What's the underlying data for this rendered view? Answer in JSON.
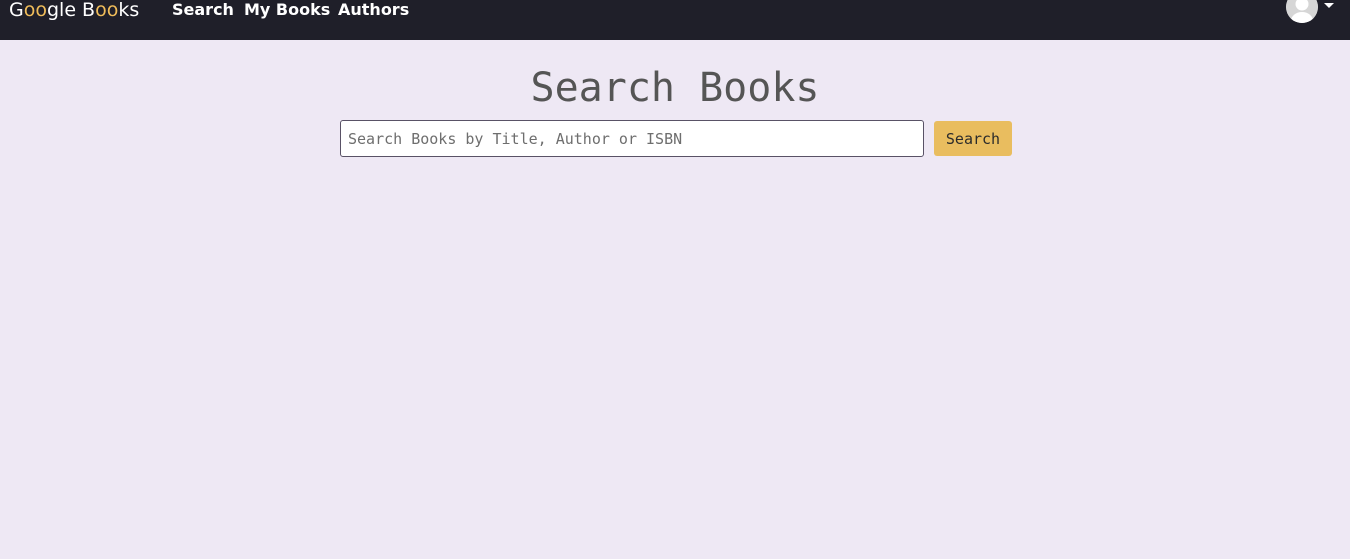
{
  "navbar": {
    "brand": {
      "parts": [
        "G",
        "oo",
        "gle B",
        "oo",
        "ks"
      ]
    },
    "links": {
      "search": "Search",
      "my_books": "My Books",
      "authors": "Authors"
    },
    "user_menu": {
      "icon": "user-avatar-icon",
      "caret_icon": "caret-down-icon"
    }
  },
  "main": {
    "title": "Search Books",
    "search": {
      "placeholder": "Search Books by Title, Author or ISBN",
      "value": "",
      "button_label": "Search"
    }
  },
  "colors": {
    "navbar_bg": "#1f1f29",
    "page_bg": "#eee8f4",
    "accent": "#e9bd5f",
    "brand_highlight": "#f0bd5a"
  }
}
